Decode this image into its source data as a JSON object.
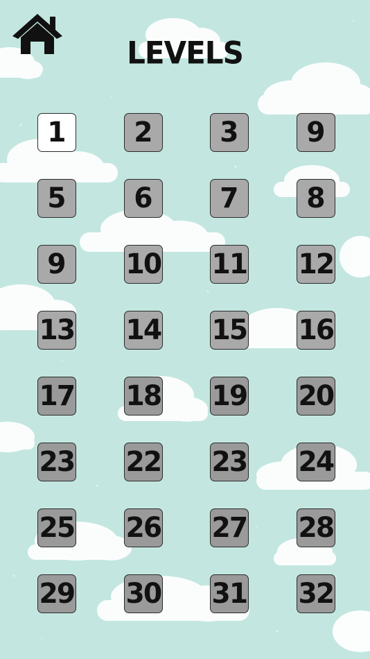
{
  "header": {
    "title": "LEVELS",
    "home_icon": "home-icon"
  },
  "colors": {
    "background": "#c3e7e0",
    "tile_unlocked": "#ffffff",
    "tile_locked": "#a9a9a9",
    "text": "#111111"
  },
  "levels": [
    "1",
    "2",
    "3",
    "9",
    "5",
    "6",
    "7",
    "8",
    "9",
    "10",
    "11",
    "12",
    "13",
    "14",
    "15",
    "16",
    "17",
    "18",
    "19",
    "20",
    "23",
    "22",
    "23",
    "24",
    "25",
    "26",
    "27",
    "28",
    "29",
    "30",
    "31",
    "32"
  ],
  "unlocked_levels": 1
}
